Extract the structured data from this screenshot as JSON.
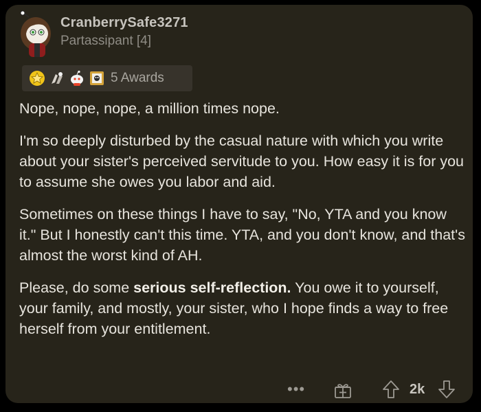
{
  "comment": {
    "author": "CranberrySafe3271",
    "flair": "Partassipant [4]",
    "awards": {
      "icons": [
        "wholesome-star-icon",
        "hands-icon",
        "snoo-award-icon",
        "framed-award-icon"
      ],
      "label": "5 Awards"
    },
    "paragraphs": [
      "Nope, nope, nope, a million times nope.",
      "I'm so deeply disturbed by the casual nature with which you write about your sister's perceived servitude to you. How easy it is for you to assume she owes you labor and aid.",
      "Sometimes on these things I have to say, \"No, YTA and you know it.\" But I honestly can't this time. YTA, and you don't know, and that's almost the worst kind of AH."
    ],
    "last_paragraph": {
      "before": "Please, do some ",
      "bold": "serious self-reflection.",
      "after": " You owe it to yourself, your family, and mostly, your sister, who I hope finds a way to free herself from your entitlement."
    }
  },
  "actions": {
    "more": "•••",
    "score": "2k"
  },
  "colors": {
    "card_background": "#27241a",
    "page_background": "#000000",
    "text": "#e7e4dd",
    "muted": "#8f8c85"
  }
}
